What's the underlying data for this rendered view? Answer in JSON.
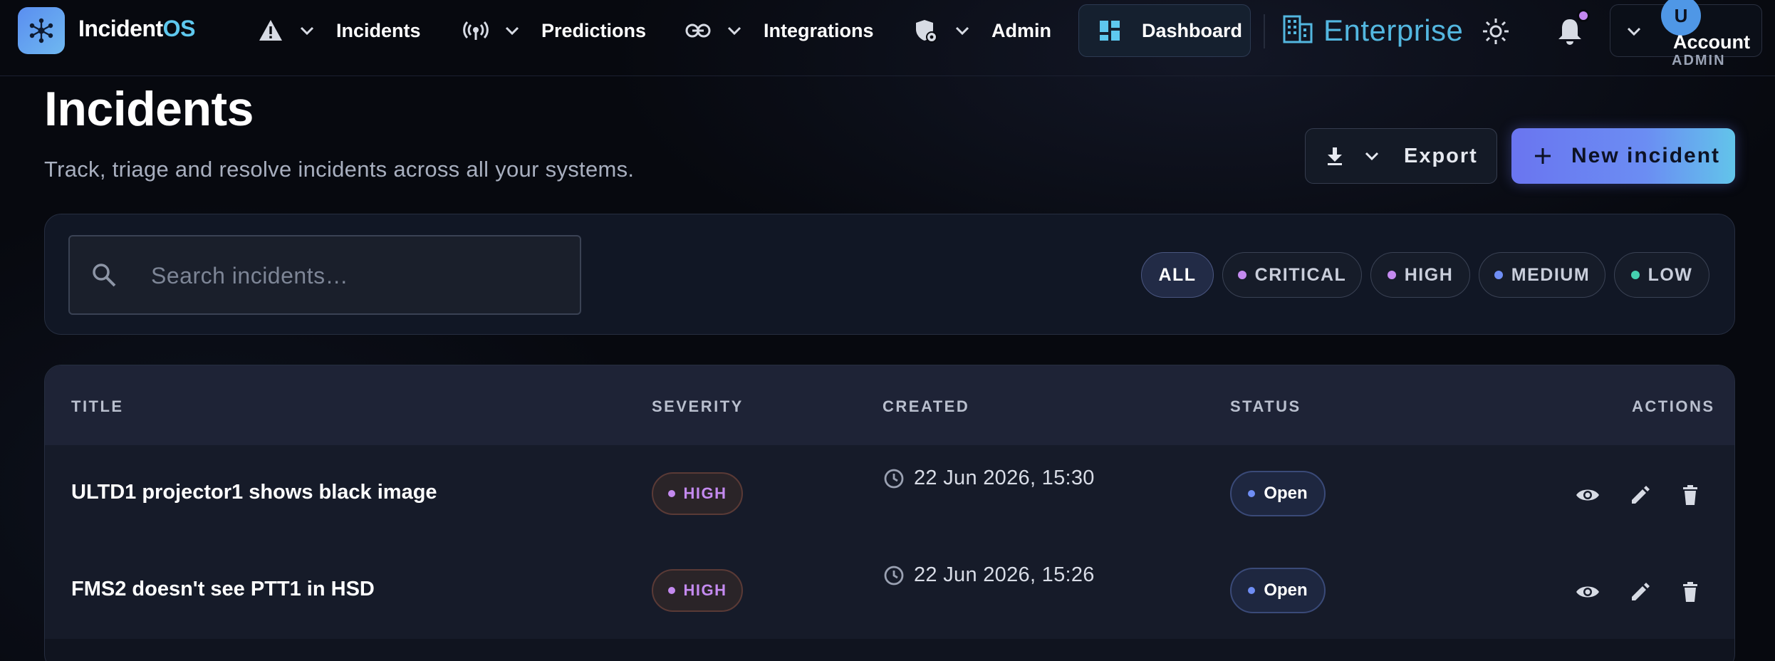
{
  "app": {
    "name_main": "Incident",
    "name_accent": "OS",
    "logo_icon": "network-nodes-icon"
  },
  "nav": {
    "items": [
      {
        "label": "Incidents",
        "icon": "warning-triangle-icon"
      },
      {
        "label": "Predictions",
        "icon": "broadcast-signal-icon"
      },
      {
        "label": "Integrations",
        "icon": "link-icon"
      },
      {
        "label": "Admin",
        "icon": "admin-shield-icon"
      }
    ],
    "dashboard_label": "Dashboard",
    "enterprise_label": "Enterprise",
    "account": {
      "initial": "U",
      "name": "Account",
      "role": "ADMIN"
    }
  },
  "header": {
    "title": "Incidents",
    "subtitle": "Track, triage and resolve incidents across all your systems.",
    "export_label": "Export",
    "new_label": "New incident"
  },
  "filters": {
    "search_placeholder": "Search incidents…",
    "chips": [
      {
        "label": "ALL",
        "active": true,
        "dot": null
      },
      {
        "label": "CRITICAL",
        "active": false,
        "dot": "#c48af0"
      },
      {
        "label": "HIGH",
        "active": false,
        "dot": "#c48af0"
      },
      {
        "label": "MEDIUM",
        "active": false,
        "dot": "#6f8ef5"
      },
      {
        "label": "LOW",
        "active": false,
        "dot": "#45d0b0"
      }
    ]
  },
  "table": {
    "columns": [
      "TITLE",
      "SEVERITY",
      "CREATED",
      "STATUS",
      "ACTIONS"
    ],
    "rows": [
      {
        "title": "ULTD1 projector1 shows black image",
        "severity": "HIGH",
        "created": "22 Jun 2026, 15:30",
        "status": "Open"
      },
      {
        "title": "FMS2 doesn't see PTT1 in HSD",
        "severity": "HIGH",
        "created": "22 Jun 2026, 15:26",
        "status": "Open"
      }
    ]
  },
  "colors": {
    "accent": "#5ec8ee",
    "primary_gradient_start": "#6a75f0",
    "primary_gradient_end": "#62c4ea",
    "severity_high": "#c48af0",
    "status_open": "#6f8ef5"
  }
}
